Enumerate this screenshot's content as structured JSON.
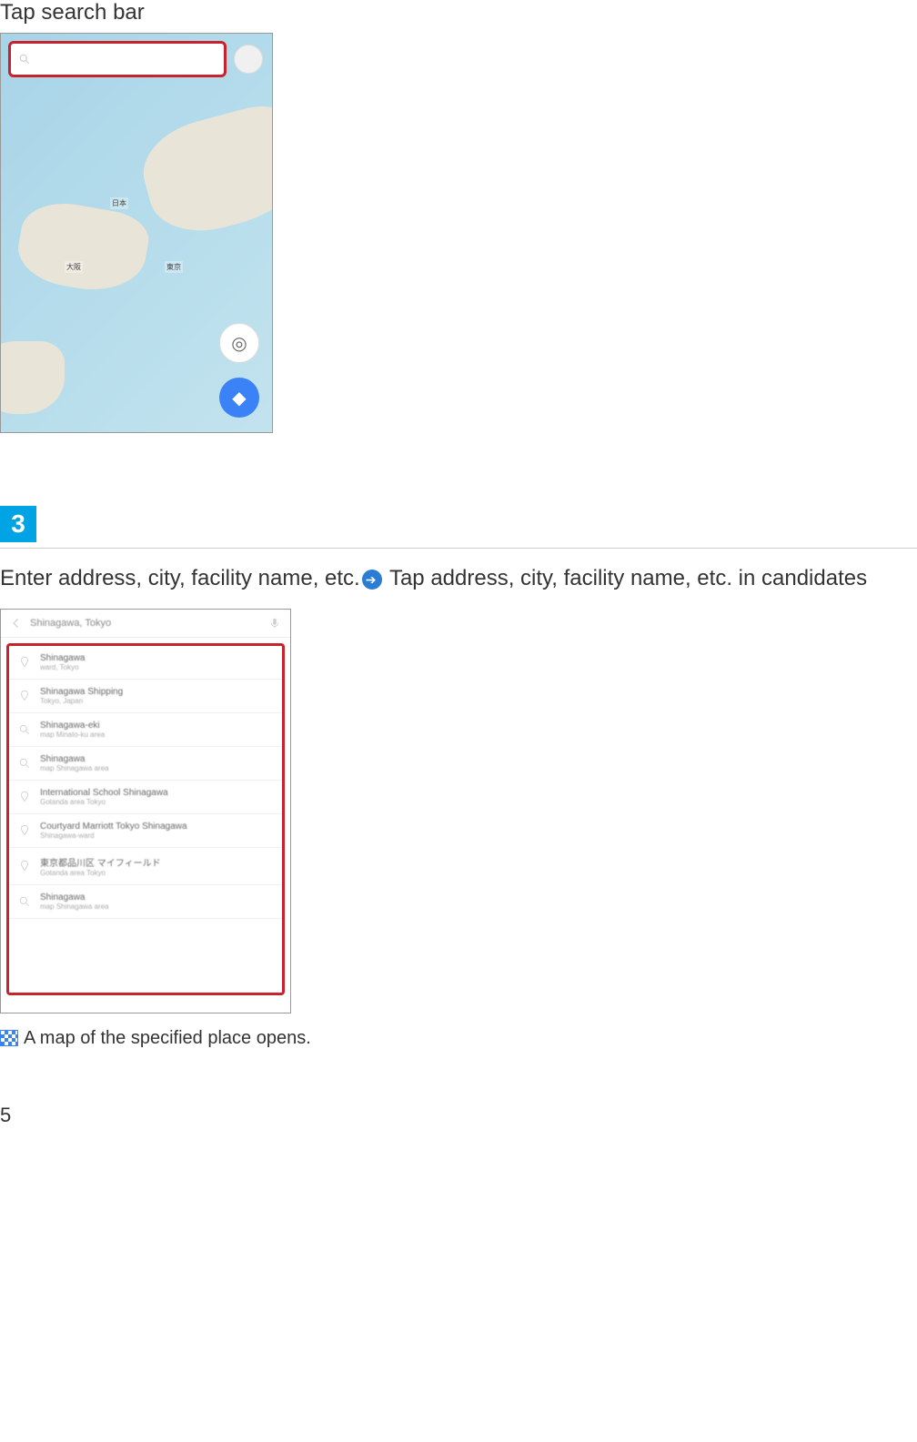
{
  "step2_text": "Tap search bar",
  "step3_badge": "3",
  "step3_instruction_a": "Enter address, city, facility name, etc.",
  "step3_instruction_b": "Tap address, city, facility name, etc. in candidates",
  "result_text": "A map of the specified place opens.",
  "page_number": "5",
  "screenshot1": {
    "search_placeholder": " ",
    "map_labels": [
      "日本",
      "大阪",
      "東京"
    ],
    "locate_icon": "◎",
    "directions_icon": "◆"
  },
  "screenshot2": {
    "query": "Shinagawa, Tokyo",
    "candidates": [
      {
        "title": "Shinagawa",
        "sub": "ward, Tokyo"
      },
      {
        "title": "Shinagawa Shipping",
        "sub": "Tokyo, Japan"
      },
      {
        "title": "Shinagawa-eki",
        "sub": "map Minato-ku area"
      },
      {
        "title": "Shinagawa",
        "sub": "map Shinagawa area"
      },
      {
        "title": "International School Shinagawa",
        "sub": "Gotanda area Tokyo"
      },
      {
        "title": "Courtyard Marriott Tokyo Shinagawa",
        "sub": "Shinagawa-ward"
      },
      {
        "title": "東京都品川区 マイフィールド",
        "sub": "Gotanda area Tokyo"
      },
      {
        "title": "Shinagawa",
        "sub": "map Shinagawa area"
      }
    ]
  }
}
